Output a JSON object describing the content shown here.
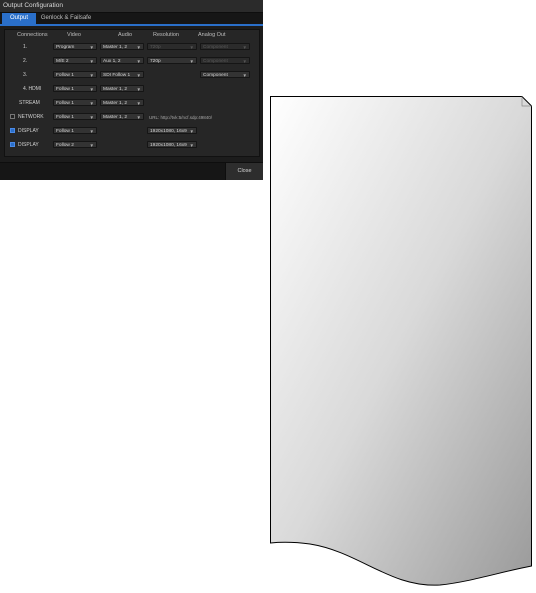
{
  "window": {
    "title": "Output Configuration"
  },
  "tabs": [
    {
      "label": "Output"
    },
    {
      "label": "Genlock & Failsafe"
    }
  ],
  "columns": {
    "connections": "Connections",
    "video": "Video",
    "audio": "Audio",
    "resolution": "Resolution",
    "analog_out": "Analog Out"
  },
  "rows": [
    {
      "label": "1.",
      "video": "Program",
      "audio": "Master 1, 2",
      "resolution": "720p",
      "analog_out": "Component"
    },
    {
      "label": "2.",
      "video": "M/E 2",
      "audio": "Aux 1, 2",
      "resolution": "720p",
      "analog_out": "Component"
    },
    {
      "label": "3.",
      "video": "Follow 1",
      "audio": "SDI Follow 1",
      "analog_out": "Component"
    },
    {
      "label": "4. HDMI",
      "video": "Follow 1",
      "audio": "Master 1, 2"
    },
    {
      "label": "STREAM",
      "video": "Follow 1",
      "audio": "Master 1, 2"
    },
    {
      "label": "NETWORK",
      "video": "Follow 1",
      "audio": "Master 1, 2",
      "url": "URL: http://tvk:5/ncf.sdp:49840/"
    },
    {
      "label": "DISPLAY",
      "video": "Follow 1",
      "resolution": "1920x1080, 16x9"
    },
    {
      "label": "DISPLAY",
      "video": "Follow 2",
      "resolution": "1920x1080, 16x9"
    }
  ],
  "footer": {
    "close_label": "Close"
  },
  "icons": {
    "dropdown": "chevron-down-icon",
    "checkbox": "checkbox-icon"
  },
  "colors": {
    "accent": "#2a6fc9",
    "panel": "#262626",
    "background": "#1c1c1c"
  }
}
